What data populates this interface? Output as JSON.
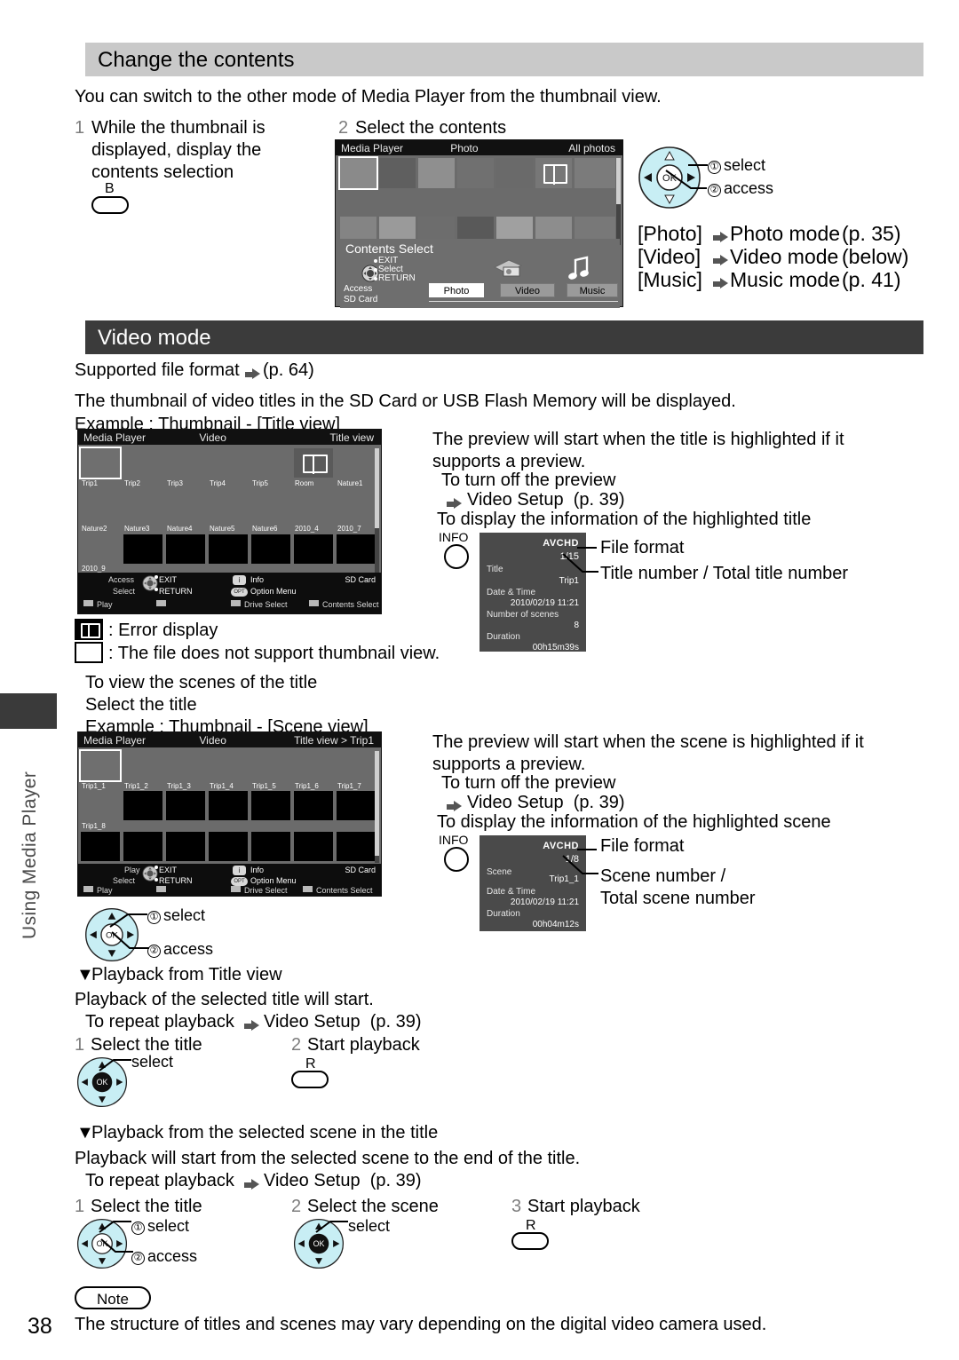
{
  "page": {
    "number": "38",
    "side_label": "Using Media Player"
  },
  "section1": {
    "header": "Change the contents",
    "intro": "You can switch to the other mode of Media Player from the thumbnail view.",
    "step1_num": "1",
    "step1_text_l1": "While the thumbnail is",
    "step1_text_l2": "displayed, display the",
    "step1_text_l3": "contents selection",
    "step1_button_letter": "B",
    "step2_num": "2",
    "step2_text": "Select the contents",
    "callout1": "select",
    "callout1_num": "①",
    "callout2": "access",
    "callout2_num": "②",
    "modes": [
      {
        "key": "[Photo]",
        "mode": "Photo mode",
        "ref": "(p. 35)"
      },
      {
        "key": "[Video]",
        "mode": "Video mode",
        "ref": "(below)"
      },
      {
        "key": "[Music]",
        "mode": "Music mode",
        "ref": "(p. 41)"
      }
    ]
  },
  "screen_photo": {
    "title_left": "Media Player",
    "title_mid": "Photo",
    "title_right": "All photos",
    "overlay_title": "Contents Select",
    "hint_exit": "EXIT",
    "hint_select": "Select",
    "hint_return": "RETURN",
    "hint_access": "Access",
    "hint_sdcard": "SD Card",
    "buttons": [
      {
        "label": "Photo",
        "selected": true
      },
      {
        "label": "Video",
        "selected": false
      },
      {
        "label": "Music",
        "selected": false
      }
    ]
  },
  "section2": {
    "header": "Video mode",
    "supported_format": "Supported file format",
    "supported_format_ref": "(p. 64)",
    "thumb_desc": "The thumbnail of video titles in the SD Card or USB Flash Memory will be displayed.",
    "example_title": "Example : Thumbnail - [Title view]",
    "preview_l1": "The preview will start when the title is highlighted if it",
    "preview_l2": "supports a preview.",
    "turnoff_l1": "To turn off the preview",
    "turnoff_l2": "Video Setup  (p. 39)",
    "info_l1": "To display the information of the highlighted title",
    "label_file_format": "File format",
    "label_number": "Title number / Total title number",
    "info_button": "INFO"
  },
  "screen_title_view": {
    "title_left": "Media Player",
    "title_mid": "Video",
    "title_right": "Title view",
    "row1": [
      "Trip1",
      "Trip2",
      "Trip3",
      "Trip4",
      "Trip5",
      "Room",
      "Nature1"
    ],
    "row2": [
      "Nature2",
      "Nature3",
      "Nature4",
      "Nature5",
      "Nature6",
      "2010_4",
      "2010_7"
    ],
    "row3": [
      "2010_9"
    ],
    "bb_access": "Access",
    "bb_select": "Select",
    "bb_exit": "EXIT",
    "bb_return": "RETURN",
    "bb_info": "Info",
    "bb_option": "Option Menu",
    "bb_sdcard": "SD Card",
    "bb_play": "Play",
    "bb_drive": "Drive Select",
    "bb_contents": "Contents Select"
  },
  "info_title": {
    "format": "AVCHD",
    "fraction": "1/15",
    "rows": [
      {
        "key": "Title",
        "value": "Trip1"
      },
      {
        "key": "Date & Time",
        "value": "2010/02/19 11:21"
      },
      {
        "key": "Number of scenes",
        "value": "8"
      },
      {
        "key": "Duration",
        "value": "00h15m39s"
      }
    ]
  },
  "legend": {
    "error_display": ": Error display",
    "no_thumbnail": ": The file does not support thumbnail view."
  },
  "section3": {
    "view_scenes_l1": "To view the scenes of the title",
    "view_scenes_l2": "Select the title",
    "example_title": "Example : Thumbnail - [Scene view]",
    "preview_l1": "The preview will start when the scene is highlighted if it",
    "preview_l2": "supports a preview.",
    "turnoff_l1": "To turn off the preview",
    "turnoff_l2": "Video Setup  (p. 39)",
    "info_l1": "To display the information of the highlighted scene",
    "label_file_format": "File format",
    "label_number_l1": "Scene number /",
    "label_number_l2": "Total scene number",
    "info_button": "INFO",
    "callout1": "select",
    "callout1_num": "①",
    "callout2": "access",
    "callout2_num": "②"
  },
  "screen_scene_view": {
    "title_left": "Media Player",
    "title_mid": "Video",
    "title_right": "Title view  >  Trip1",
    "row1": [
      "Trip1_1",
      "Trip1_2",
      "Trip1_3",
      "Trip1_4",
      "Trip1_5",
      "Trip1_6",
      "Trip1_7"
    ],
    "row2": [
      "Trip1_8"
    ],
    "bb_play_top": "Play",
    "bb_select": "Select",
    "bb_exit": "EXIT",
    "bb_return": "RETURN",
    "bb_info": "Info",
    "bb_option": "Option Menu",
    "bb_sdcard": "SD Card",
    "bb_play": "Play",
    "bb_drive": "Drive Select",
    "bb_contents": "Contents Select"
  },
  "info_scene": {
    "format": "AVCHD",
    "fraction": "1/8",
    "rows": [
      {
        "key": "Scene",
        "value": "Trip1_1"
      },
      {
        "key": "Date & Time",
        "value": "2010/02/19 11:21"
      },
      {
        "key": "Duration",
        "value": "00h04m12s"
      }
    ]
  },
  "playback_title": {
    "marker": "▼",
    "heading": "Playback from Title view",
    "desc": "Playback of the selected title will start.",
    "repeat_l": "To repeat playback",
    "repeat_r": "Video Setup  (p. 39)",
    "step1_num": "1",
    "step1_text": "Select the title",
    "step1_callout": "select",
    "step2_num": "2",
    "step2_text": "Start playback",
    "step2_button_letter": "R"
  },
  "playback_scene": {
    "marker": "▼",
    "heading": "Playback from the selected scene in the title",
    "desc": "Playback will start from the selected scene to the end of the title.",
    "repeat_l": "To repeat playback",
    "repeat_r": "Video Setup  (p. 39)",
    "step1_num": "1",
    "step1_text": "Select the title",
    "step1_c1_num": "①",
    "step1_c1": "select",
    "step1_c2_num": "②",
    "step1_c2": "access",
    "step2_num": "2",
    "step2_text": "Select the scene",
    "step2_callout": "select",
    "step3_num": "3",
    "step3_text": "Start playback",
    "step3_button_letter": "R"
  },
  "note": {
    "label": "Note",
    "text": "The structure of titles and scenes may vary depending on the digital video camera used."
  },
  "colors": {
    "header_gray": "#c9c9c9",
    "header_dark": "#3b3b3b",
    "screen_bg": "#6b6b6b",
    "dpad_fill": "#c8eef4",
    "info_panel": "#4a4a4a"
  }
}
